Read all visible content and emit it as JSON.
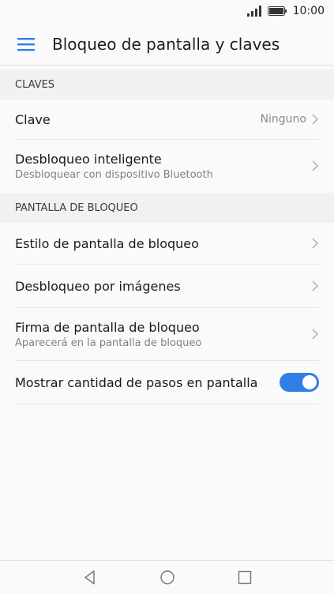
{
  "status": {
    "time": "10:00",
    "signal_icon": "signal-icon",
    "battery_icon": "battery-icon"
  },
  "header": {
    "title": "Bloqueo de pantalla y claves",
    "menu_icon": "hamburger-menu-icon"
  },
  "sections": {
    "keys": {
      "header": "CLAVES",
      "password": {
        "title": "Clave",
        "value": "Ninguno"
      },
      "smart_unlock": {
        "title": "Desbloqueo inteligente",
        "subtitle": "Desbloquear con dispositivo Bluetooth"
      }
    },
    "lockscreen": {
      "header": "PANTALLA DE BLOQUEO",
      "style": {
        "title": "Estilo de pantalla de bloqueo"
      },
      "image_unlock": {
        "title": "Desbloqueo por imágenes"
      },
      "signature": {
        "title": "Firma de pantalla de bloqueo",
        "subtitle": "Aparecerá en la pantalla de bloqueo"
      },
      "steps": {
        "title": "Mostrar cantidad de pasos en pantalla",
        "toggle_on": true
      }
    }
  },
  "nav": {
    "back_icon": "back-icon",
    "home_icon": "home-icon",
    "recents_icon": "recents-icon"
  },
  "colors": {
    "accent": "#2f7fe6",
    "background": "#fafafa",
    "section_bg": "#f1f1f1"
  }
}
